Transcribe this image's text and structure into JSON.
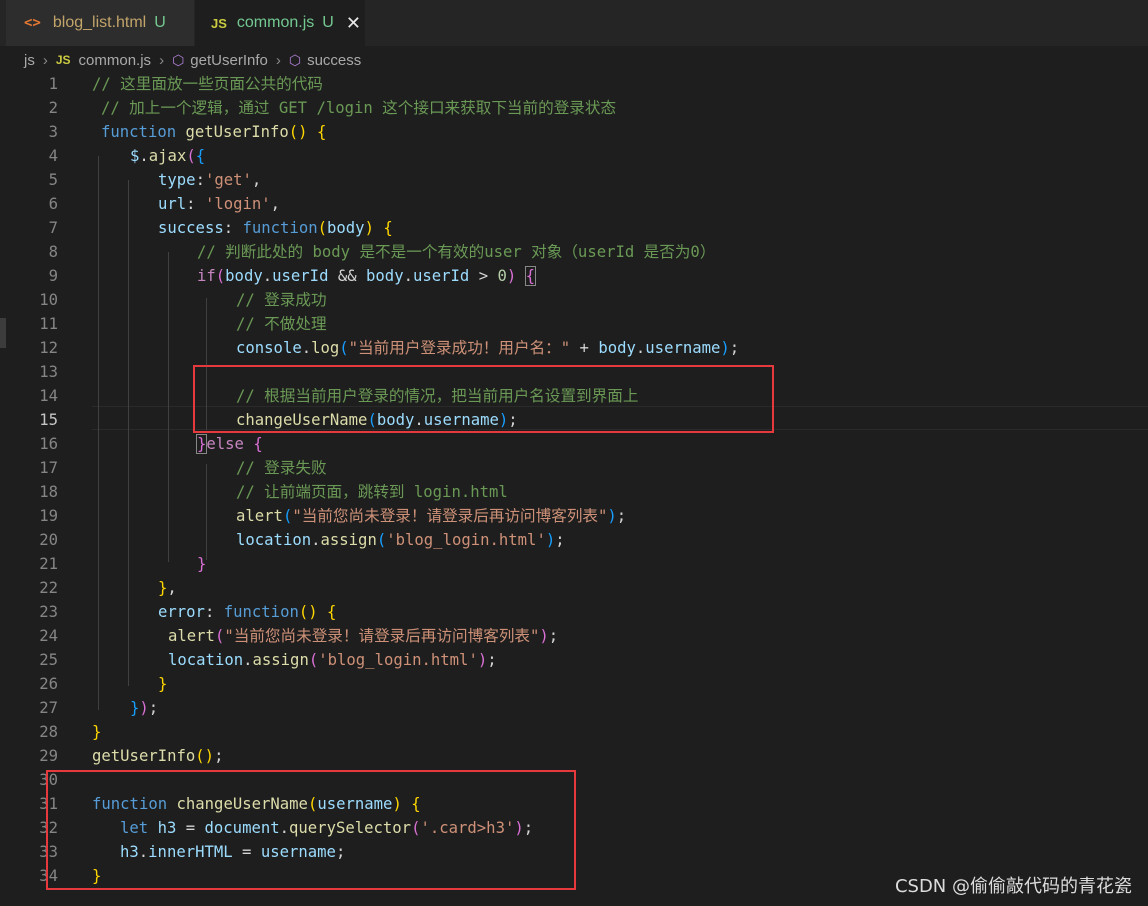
{
  "tabs": [
    {
      "icon": "<>",
      "name": "blog_list.html",
      "status": "U"
    },
    {
      "icon": "JS",
      "name": "common.js",
      "status": "U",
      "close": "✕"
    }
  ],
  "breadcrumb": {
    "folder": "js",
    "file_icon": "JS",
    "file": "common.js",
    "symbol1": "getUserInfo",
    "symbol2": "success"
  },
  "lines": [
    "1",
    "2",
    "3",
    "4",
    "5",
    "6",
    "7",
    "8",
    "9",
    "10",
    "11",
    "12",
    "13",
    "14",
    "15",
    "16",
    "17",
    "18",
    "19",
    "20",
    "21",
    "22",
    "23",
    "24",
    "25",
    "26",
    "27",
    "28",
    "29",
    "30",
    "31",
    "32",
    "33",
    "34"
  ],
  "code": {
    "l1": "// 这里面放一些页面公共的代码",
    "l2": "// 加上一个逻辑，通过 GET /login 这个接口来获取下当前的登录状态",
    "l3a": "function",
    "l3b": "getUserInfo",
    "l4a": "$",
    "l4b": "ajax",
    "l5a": "type",
    "l5b": "'get'",
    "l6a": "url",
    "l6b": "'login'",
    "l7a": "success",
    "l7b": "function",
    "l7c": "body",
    "l8": "// 判断此处的 body 是不是一个有效的user 对象（userId 是否为0）",
    "l9a": "if",
    "l9b": "body",
    "l9c": "userId",
    "l9d": "body",
    "l9e": "userId",
    "l9f": "0",
    "l10": "// 登录成功",
    "l11": "// 不做处理",
    "l12a": "console",
    "l12b": "log",
    "l12c": "\"当前用户登录成功！用户名：\"",
    "l12d": "body",
    "l12e": "username",
    "l14": "// 根据当前用户登录的情况，把当前用户名设置到界面上",
    "l15a": "changeUserName",
    "l15b": "body",
    "l15c": "username",
    "l16": "else",
    "l17": "// 登录失败",
    "l18": "// 让前端页面，跳转到 login.html",
    "l19a": "alert",
    "l19b": "\"当前您尚未登录！请登录后再访问博客列表\"",
    "l20a": "location",
    "l20b": "assign",
    "l20c": "'blog_login.html'",
    "l23a": "error",
    "l23b": "function",
    "l24a": "alert",
    "l24b": "\"当前您尚未登录！请登录后再访问博客列表\"",
    "l25a": "location",
    "l25b": "assign",
    "l25c": "'blog_login.html'",
    "l29": "getUserInfo",
    "l31a": "function",
    "l31b": "changeUserName",
    "l31c": "username",
    "l32a": "let",
    "l32b": "h3",
    "l32c": "document",
    "l32d": "querySelector",
    "l32e": "'.card>h3'",
    "l33a": "h3",
    "l33b": "innerHTML",
    "l33c": "username"
  },
  "watermark": "CSDN @偷偷敲代码的青花瓷",
  "colors": {
    "highlight_box": "#e5393e",
    "comment": "#6a9955",
    "keyword": "#569cd6"
  }
}
